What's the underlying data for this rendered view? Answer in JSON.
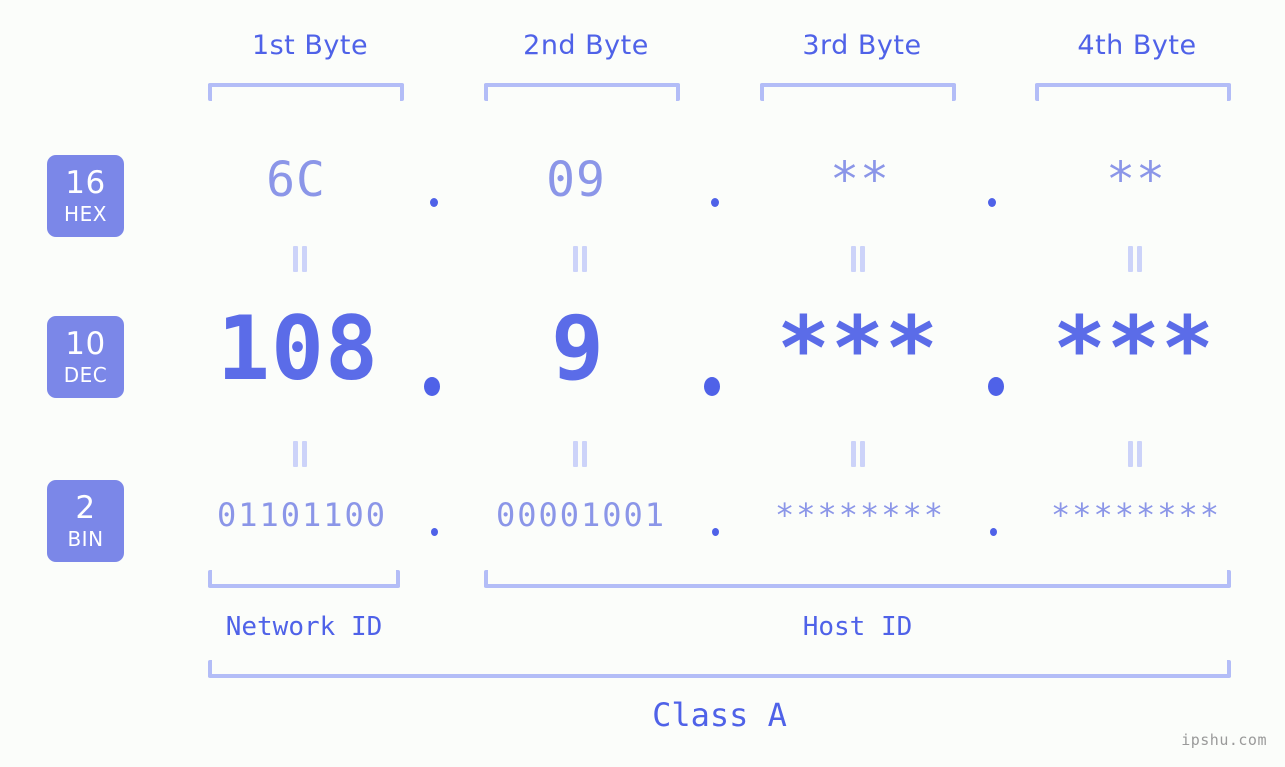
{
  "background_color": "#fbfdfa",
  "accent_color": "#4f62e8",
  "badge_color": "#7b87e8",
  "bracket_color": "#b3bdf7",
  "byte_headers": [
    {
      "label": "1st Byte"
    },
    {
      "label": "2nd Byte"
    },
    {
      "label": "3rd Byte"
    },
    {
      "label": "4th Byte"
    }
  ],
  "rows": [
    {
      "badge_number": "16",
      "badge_name": "HEX",
      "values": [
        "6C",
        "09",
        "**",
        "**"
      ]
    },
    {
      "badge_number": "10",
      "badge_name": "DEC",
      "values": [
        "108",
        "9",
        "***",
        "***"
      ]
    },
    {
      "badge_number": "2",
      "badge_name": "BIN",
      "values": [
        "01101100",
        "00001001",
        "********",
        "********"
      ]
    }
  ],
  "separator": ".",
  "equals_marks": {
    "hex_to_dec": [
      "=",
      "=",
      "=",
      "="
    ],
    "dec_to_bin": [
      "=",
      "=",
      "=",
      "="
    ]
  },
  "spans": {
    "network_id": "Network ID",
    "host_id": "Host ID",
    "class": "Class A"
  },
  "watermark": "ipshu.com"
}
